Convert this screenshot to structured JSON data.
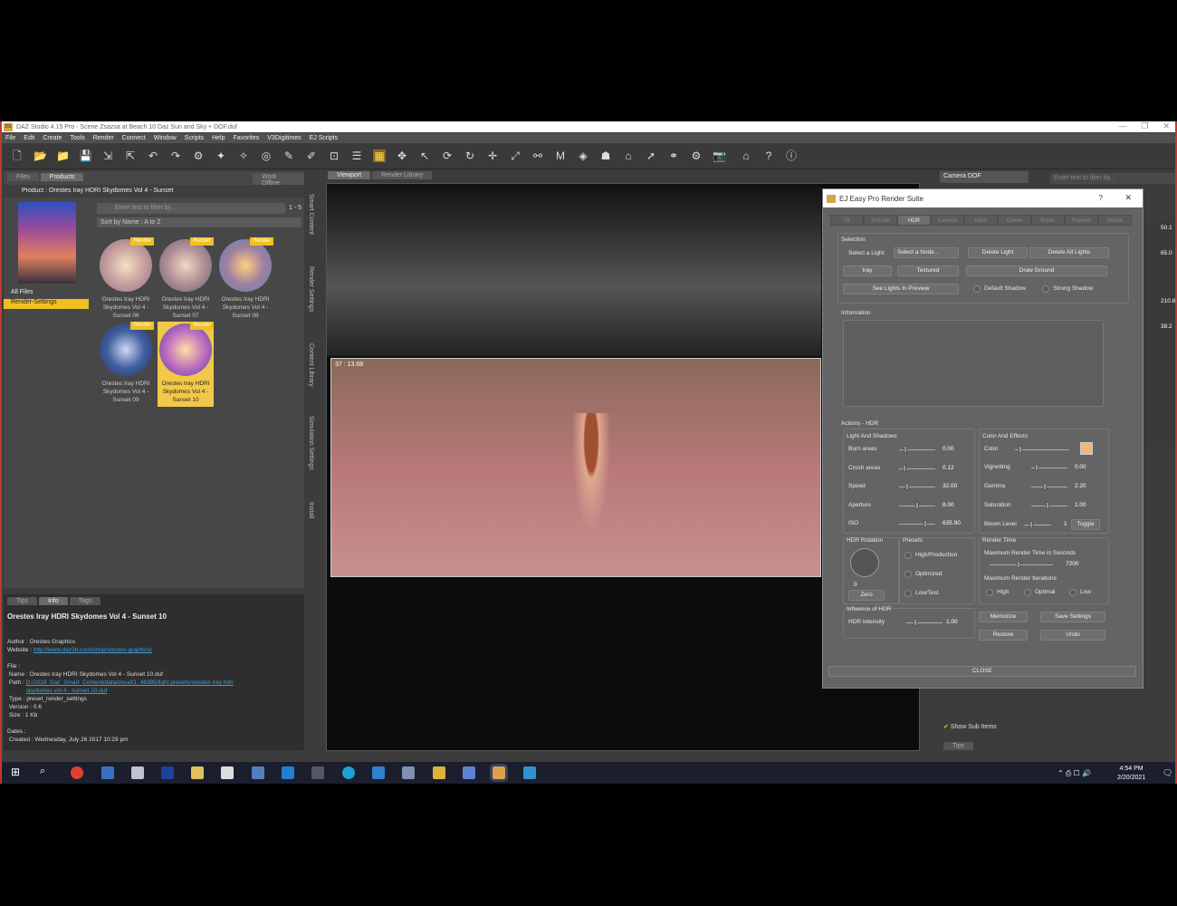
{
  "window": {
    "title": "DAZ Studio 4.15 Pro - Scene Zsazsa at Beach 10 Daz Sun and Sky + DOF.duf",
    "app_icon": "DS"
  },
  "menu": [
    "File",
    "Edit",
    "Create",
    "Tools",
    "Render",
    "Connect",
    "Window",
    "Scripts",
    "Help",
    "Favorites",
    "V3Digitimes",
    "EJ Scripts"
  ],
  "left_panel": {
    "tabs": [
      "Files",
      "Products"
    ],
    "work_offline": "Work Offline",
    "product_title": "Product : Orestes Iray HDRI Skydomes Vol 4 - Sunset",
    "filter_placeholder": "Enter text to filter by...",
    "page_range": "1 - 5",
    "sort": "Sort by Name : A to Z",
    "folders": [
      "All Files",
      "Render-Settings"
    ],
    "items": [
      {
        "name": "Orestes Iray HDRI Skydomes Vol 4 - Sunset 06",
        "badge": "Render"
      },
      {
        "name": "Orestes Iray HDRI Skydomes Vol 4 - Sunset 07",
        "badge": "Render"
      },
      {
        "name": "Orestes Iray HDRI Skydomes Vol 4 - Sunset 08",
        "badge": "Render"
      },
      {
        "name": "Orestes Iray HDRI Skydomes Vol 4 - Sunset 09",
        "badge": "Render"
      },
      {
        "name": "Orestes Iray HDRI Skydomes Vol 4 - Sunset 10",
        "badge": "Render"
      }
    ],
    "side_tabs": [
      "Smart Content",
      "Render Settings",
      "Content Library",
      "Simulation Settings",
      "Install"
    ]
  },
  "info_panel": {
    "tabs": [
      "Tips",
      "Info",
      "Tags"
    ],
    "title": "Orestes Iray HDRI Skydomes Vol 4 - Sunset 10",
    "author_label": "Author :",
    "author": "Orestes Graphics",
    "website_label": "Website :",
    "website": "http://www.daz3d.com/shop/orestes-graphics/",
    "file_label": "File :",
    "name_label": "Name :",
    "name": "Orestes Iray HDRI Skydomes Vol 4 - Sunset 10.duf",
    "path_label": "Path :",
    "path": "D:/2018_Daz_Smart_Content/data/cloud/1_48385/light presets/orestes iray hdri skydomes vol 4 - sunset 10.duf",
    "type_label": "Type :",
    "type": "preset_render_settings",
    "version_label": "Version :",
    "version": "0.6",
    "size_label": "Size :",
    "size": "1 Kb",
    "dates_label": "Dates :",
    "created_label": "Created :",
    "created": "Wednesday, July 26 2017 10:29 pm"
  },
  "viewport": {
    "tabs": [
      "Viewport",
      "Render Library"
    ],
    "overlay": "37 : 13.68"
  },
  "right_panel": {
    "camera": "Camera DOF",
    "filter_placeholder": "Enter text to filter by...",
    "values": [
      "50.1",
      "65.0",
      "210.8",
      "38.2"
    ],
    "show_sub_items": "Show Sub Items",
    "tips": "Tips"
  },
  "dialog": {
    "title": "EJ Easy Pro Render Suite",
    "help": "?",
    "close_x": "✕",
    "tabs": [
      "Fit",
      "Smooth",
      "HDR",
      "Camera",
      "Hider",
      "Corner",
      "Poser",
      "Preview",
      "Scene"
    ],
    "selection": {
      "label": "Selection",
      "select_light": "Select a Light",
      "select_node": "Select a Node...",
      "delete_light": "Delete Light",
      "delete_all": "Delete All Lights",
      "iray": "Iray",
      "textured": "Textured",
      "draw_ground": "Draw Ground",
      "see_lights": "See Lights In Preview",
      "default_shadow": "Default Shadow",
      "strong_shadow": "Strong Shadow"
    },
    "information": "Information",
    "actions": "Actions - HDR",
    "light_shadows": {
      "label": "Light And Shadows",
      "rows": [
        {
          "name": "Burn areas",
          "value": "0.00",
          "pos": 0.15
        },
        {
          "name": "Crush areas",
          "value": "0.12",
          "pos": 0.1
        },
        {
          "name": "Speed",
          "value": "32.00",
          "pos": 0.2
        },
        {
          "name": "Aperture",
          "value": "8.00",
          "pos": 0.5
        },
        {
          "name": "ISO",
          "value": "635.90",
          "pos": 0.75
        }
      ]
    },
    "color_effects": {
      "label": "Color And Effects",
      "color_label": "Color",
      "swatch": "#f2b77a",
      "rows": [
        {
          "name": "Vignetting",
          "value": "0.00",
          "pos": 0.1
        },
        {
          "name": "Gamma",
          "value": "2.20",
          "pos": 0.35
        },
        {
          "name": "Saturation",
          "value": "1.00",
          "pos": 0.45
        }
      ],
      "bloom_label": "Bloom Level",
      "bloom_value": "1",
      "toggle": "Toggle"
    },
    "hdr_rotation": {
      "label": "HDR Rotation",
      "value": "0",
      "zero": "Zero"
    },
    "presets": {
      "label": "Presets",
      "items": [
        "High/Production",
        "Optimized",
        "Low/Test"
      ]
    },
    "render_time": {
      "label": "Render Time",
      "max_time": "Maximum Render Time in Seconds",
      "time_value": "7200",
      "max_iter": "Maximum Render Iterations",
      "iters": [
        "High",
        "Optimal",
        "Low"
      ]
    },
    "influence": {
      "label": "Influence of HDR",
      "intensity": "HDR Intensity",
      "value": "1.00"
    },
    "memorize": "Memorize",
    "save_settings": "Save Settings",
    "restore": "Restore",
    "undo": "Undo",
    "close": "CLOSE"
  },
  "taskbar": {
    "time": "4:54 PM",
    "date": "2/20/2021"
  }
}
